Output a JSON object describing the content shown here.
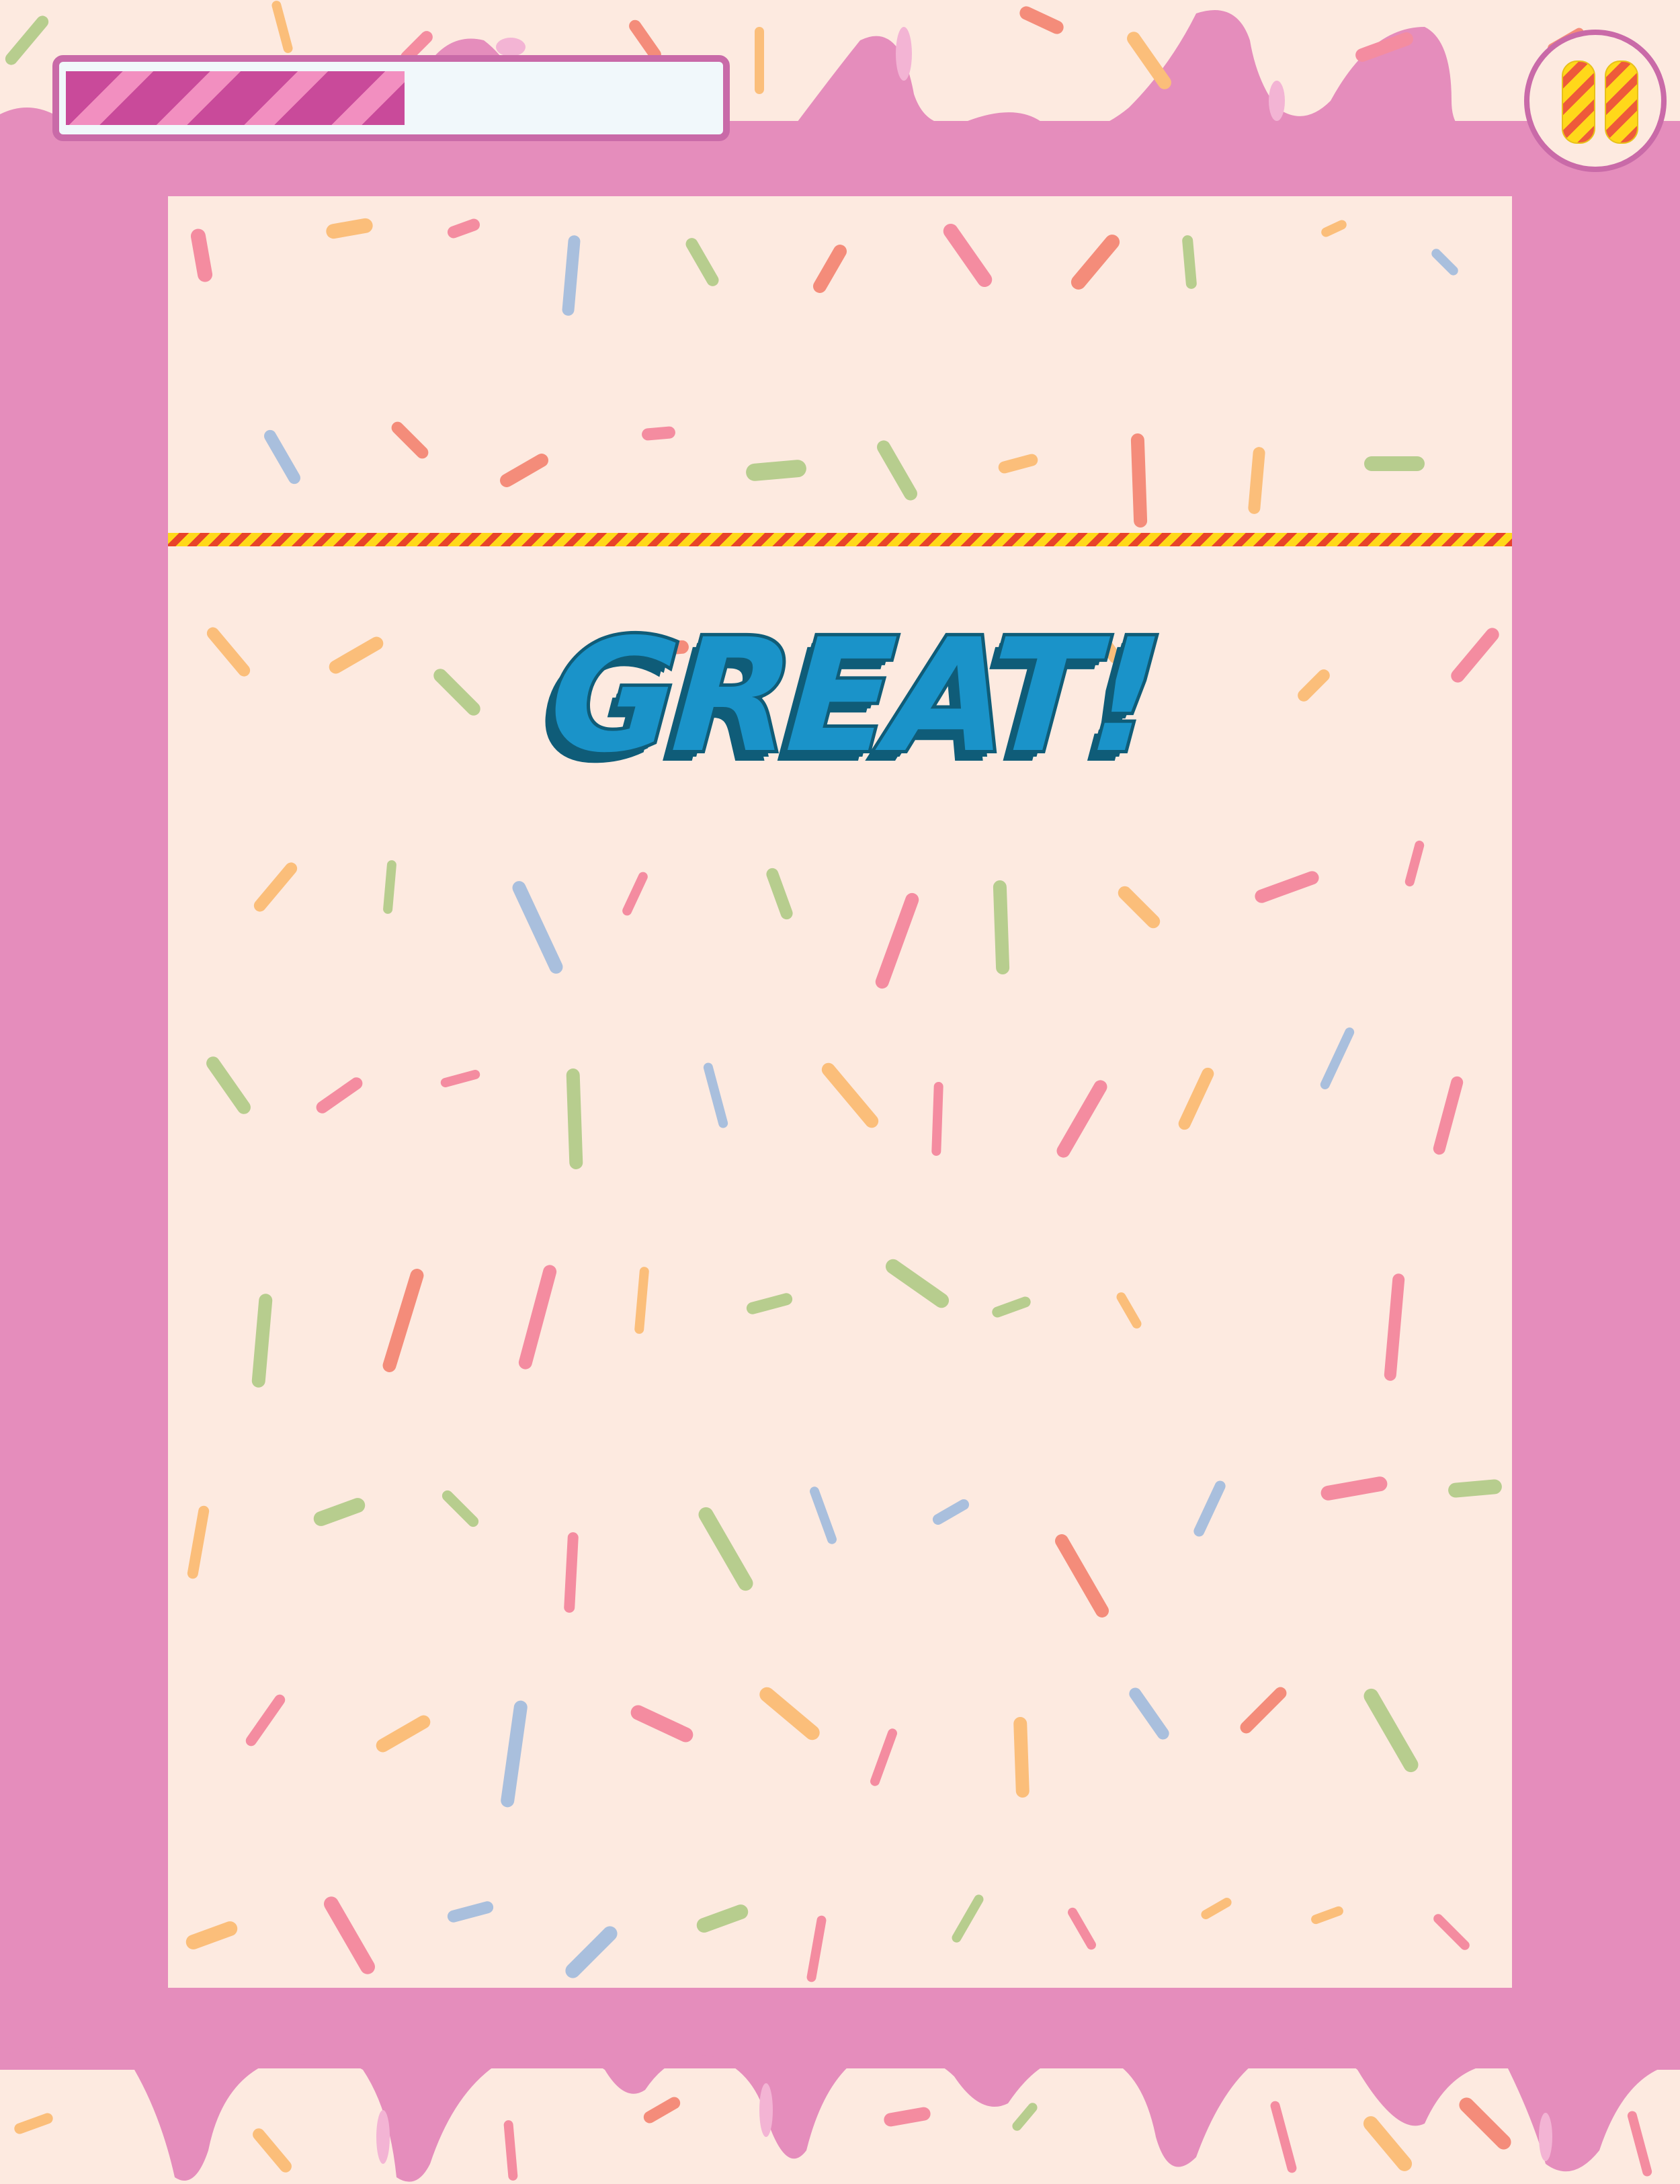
{
  "hud": {
    "progress": 0.51,
    "progress_label": "",
    "pause_icon": "pause-icon"
  },
  "board": {
    "finish_line": "candy-stripe-line"
  },
  "feedback": {
    "text": "GREAT!"
  },
  "theme": {
    "frame": "#e58dbc",
    "playfield": "#fdeae0",
    "progress_fill": "#c94a9a",
    "text_fill": "#1a93c9",
    "text_shadow": "#0f5c78",
    "sprinkle_colors": [
      "#f48ca0",
      "#b7cd8e",
      "#fbbe7a",
      "#a9bfdd",
      "#f48c7a"
    ]
  }
}
